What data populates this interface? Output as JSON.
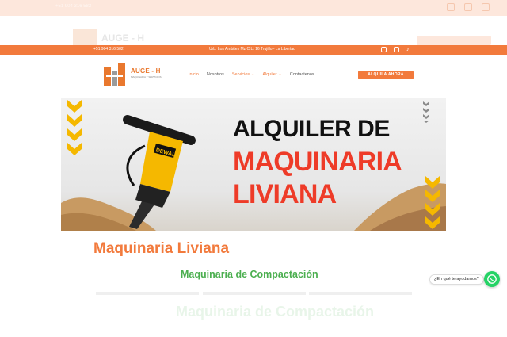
{
  "background_page": {
    "phone": "+51 904 316 582",
    "logo_text": "AUGE - H",
    "heading": "Maquinaria de Compactación"
  },
  "topbar": {
    "phone": "+51 904 316 582",
    "address": "Urb. Los Ambites Mz C Lt 16 Trujillo - La Libertad",
    "social_icons": [
      "facebook-icon",
      "instagram-icon",
      "tiktok-icon"
    ]
  },
  "header": {
    "logo": {
      "name": "AUGE - H",
      "tagline": "MAQUINARIA Y SERVICIOS"
    },
    "nav": [
      {
        "label": "Inicio",
        "state": "active"
      },
      {
        "label": "Nosotros",
        "state": "normal"
      },
      {
        "label": "Servicios ⌄",
        "state": "orange"
      },
      {
        "label": "Alquiler ⌄",
        "state": "orange"
      },
      {
        "label": "Contactenos",
        "state": "normal"
      }
    ],
    "cta": "ALQUILA AHORA"
  },
  "banner": {
    "line1": "ALQUILER DE",
    "line2": "MAQUINARIA",
    "line3": "LIVIANA",
    "tool_brand": "DEWALT"
  },
  "content": {
    "title": "Maquinaria Liviana",
    "subtitle": "Maquinaria de Compactación"
  },
  "whatsapp": {
    "label": "¿En qué te ayudamos?"
  },
  "colors": {
    "accent": "#f27a3c",
    "red": "#ee3b28",
    "green": "#4caf50",
    "whatsapp": "#25d366",
    "chevron_yellow": "#f5b800"
  }
}
